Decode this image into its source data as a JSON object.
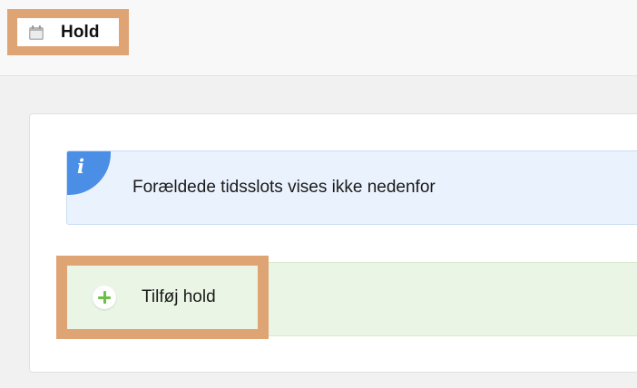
{
  "header": {
    "title": "Hold",
    "icon": "calendar-icon"
  },
  "info": {
    "icon": "info-icon",
    "glyph": "i",
    "message": "Forældede tidsslots vises ikke nedenfor"
  },
  "actions": {
    "add_label": "Tilføj hold",
    "add_icon": "plus-icon"
  },
  "colors": {
    "highlight": "#dfa474",
    "info_bg": "#eaf2fd",
    "info_accent": "#4a8ee6",
    "add_bg": "#eaf5e5",
    "plus_green": "#6cc04a"
  }
}
